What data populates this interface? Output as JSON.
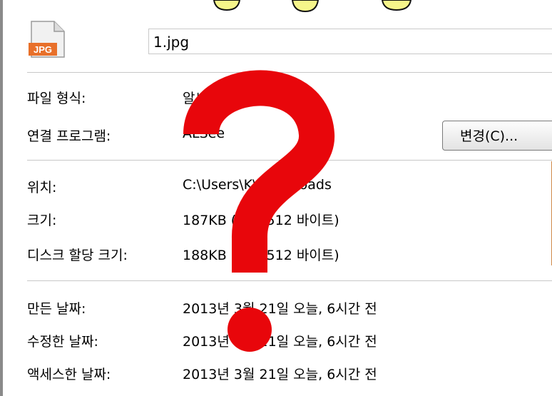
{
  "file": {
    "icon_label": "JPG",
    "name": "1.jpg"
  },
  "properties": {
    "file_type_label": "파일 형식:",
    "file_type_value": "알씨 이미지 파일(.jpg)",
    "opens_with_label": "연결 프로그램:",
    "opens_with_value": "ALSee",
    "change_button": "변경(C)...",
    "location_label": "위치:",
    "location_value": "C:\\Users\\K\\Downloads",
    "size_label": "크기:",
    "size_value": "187KB (191,512 바이트)",
    "size_on_disk_label": "디스크 할당 크기:",
    "size_on_disk_value": "188KB (192,512 바이트)",
    "created_label": "만든 날짜:",
    "created_value": "2013년 3월 21일 오늘, 6시간 전",
    "modified_label": "수정한 날짜:",
    "modified_value": "2013년 3월 21일 오늘, 6시간 전",
    "accessed_label": "액세스한 날짜:",
    "accessed_value": "2013년 3월 21일 오늘, 6시간 전"
  },
  "overlay": {
    "symbol": "?",
    "color": "#e8060b"
  },
  "colors": {
    "top_blob_fill": "#f6f58a",
    "icon_badge": "#e8702a"
  }
}
